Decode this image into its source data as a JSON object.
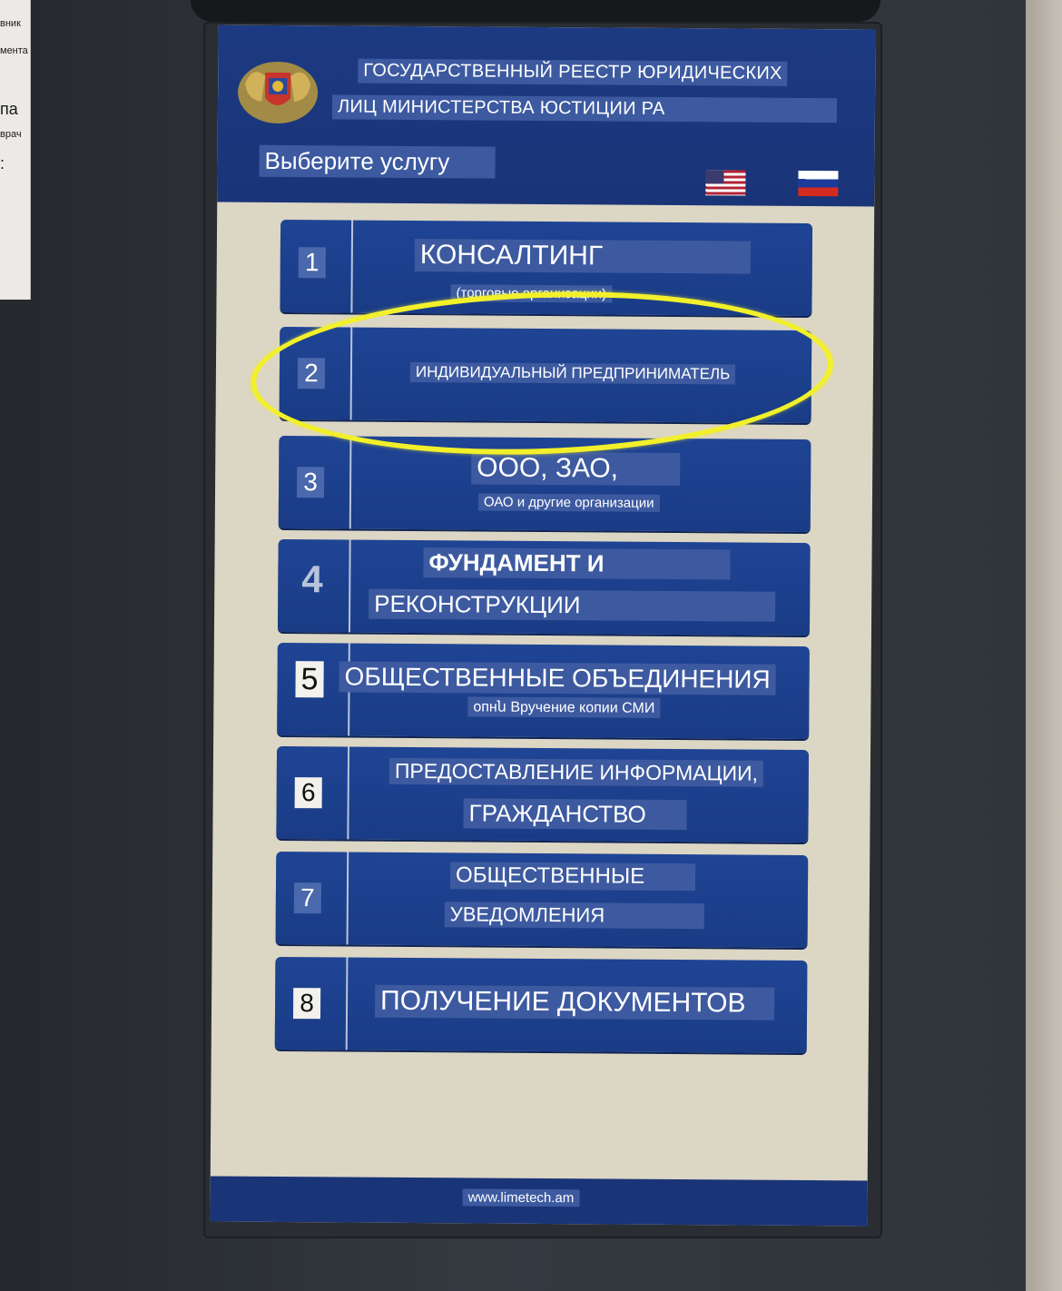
{
  "side_paper": {
    "lines": [
      "вник",
      "мента",
      "па",
      "врач",
      ":"
    ]
  },
  "header": {
    "title_line_1": "ГОСУДАРСТВЕННЫЙ РЕЕСТР ЮРИДИЧЕСКИХ",
    "title_line_2": "ЛИЦ МИНИСТЕРСТВА ЮСТИЦИИ РА",
    "prompt": "Выберите услугу",
    "languages": [
      "English",
      "Русский"
    ]
  },
  "services": [
    {
      "number": "1",
      "lines": [
        "КОНСАЛТИНГ"
      ],
      "subtitle": "(торговые организации)"
    },
    {
      "number": "2",
      "lines": [
        "ИНДИВИДУАЛЬНЫЙ ПРЕДПРИНИМАТЕЛЬ"
      ],
      "subtitle": ""
    },
    {
      "number": "3",
      "lines": [
        "ООО, ЗАО,"
      ],
      "subtitle": "ОАО и другие организации"
    },
    {
      "number": "4",
      "lines": [
        "ФУНДАМЕНТ И",
        "РЕКОНСТРУКЦИИ"
      ],
      "subtitle": ""
    },
    {
      "number": "5",
      "lines": [
        "ОБЩЕСТВЕННЫЕ ОБЪЕДИНЕНИЯ"
      ],
      "subtitle": "опнն Вручение копии СМИ"
    },
    {
      "number": "6",
      "lines": [
        "ПРЕДОСТАВЛЕНИЕ ИНФОРМАЦИИ,",
        "ГРАЖДАНСТВО"
      ],
      "subtitle": ""
    },
    {
      "number": "7",
      "lines": [
        "ОБЩЕСТВЕННЫЕ",
        "УВЕДОМЛЕНИЯ"
      ],
      "subtitle": ""
    },
    {
      "number": "8",
      "lines": [
        "ПОЛУЧЕНИЕ ДОКУМЕНТОВ"
      ],
      "subtitle": ""
    }
  ],
  "footer": {
    "url": "www.limetech.am"
  },
  "colors": {
    "header_blue": "#1c3a82",
    "button_blue": "#1f4494",
    "screen_background": "#dcd6c4",
    "highlight_yellow": "#f2f02a"
  },
  "annotation": {
    "highlighted_service": "2"
  }
}
